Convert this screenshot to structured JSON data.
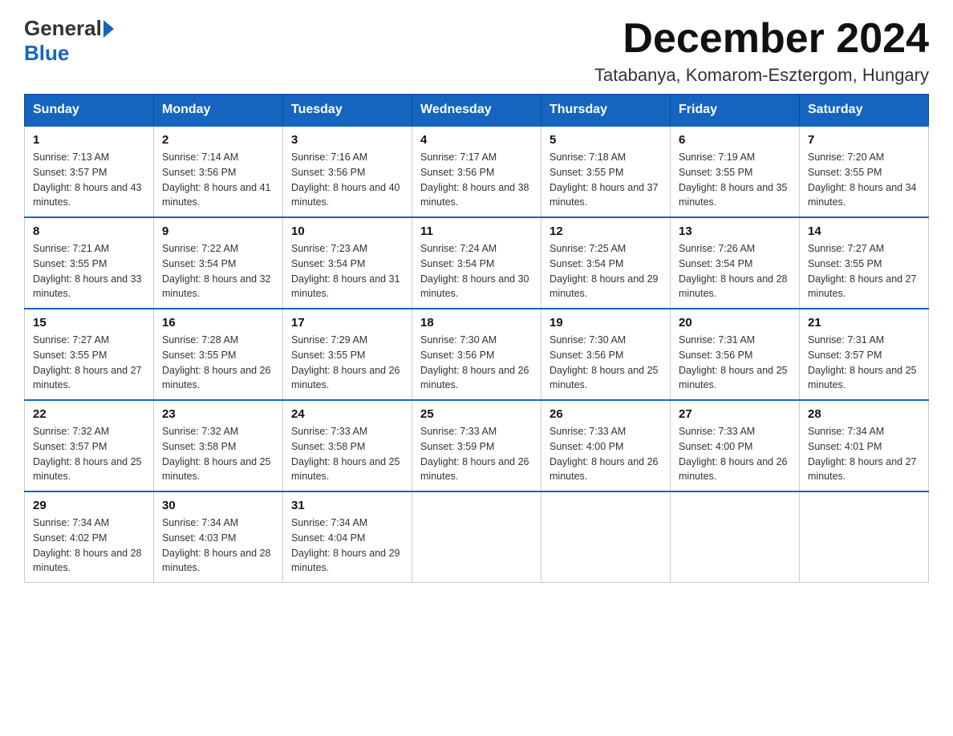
{
  "logo": {
    "general": "General",
    "blue": "Blue"
  },
  "title": "December 2024",
  "location": "Tatabanya, Komarom-Esztergom, Hungary",
  "weekdays": [
    "Sunday",
    "Monday",
    "Tuesday",
    "Wednesday",
    "Thursday",
    "Friday",
    "Saturday"
  ],
  "weeks": [
    [
      {
        "day": "1",
        "sunrise": "7:13 AM",
        "sunset": "3:57 PM",
        "daylight": "8 hours and 43 minutes."
      },
      {
        "day": "2",
        "sunrise": "7:14 AM",
        "sunset": "3:56 PM",
        "daylight": "8 hours and 41 minutes."
      },
      {
        "day": "3",
        "sunrise": "7:16 AM",
        "sunset": "3:56 PM",
        "daylight": "8 hours and 40 minutes."
      },
      {
        "day": "4",
        "sunrise": "7:17 AM",
        "sunset": "3:56 PM",
        "daylight": "8 hours and 38 minutes."
      },
      {
        "day": "5",
        "sunrise": "7:18 AM",
        "sunset": "3:55 PM",
        "daylight": "8 hours and 37 minutes."
      },
      {
        "day": "6",
        "sunrise": "7:19 AM",
        "sunset": "3:55 PM",
        "daylight": "8 hours and 35 minutes."
      },
      {
        "day": "7",
        "sunrise": "7:20 AM",
        "sunset": "3:55 PM",
        "daylight": "8 hours and 34 minutes."
      }
    ],
    [
      {
        "day": "8",
        "sunrise": "7:21 AM",
        "sunset": "3:55 PM",
        "daylight": "8 hours and 33 minutes."
      },
      {
        "day": "9",
        "sunrise": "7:22 AM",
        "sunset": "3:54 PM",
        "daylight": "8 hours and 32 minutes."
      },
      {
        "day": "10",
        "sunrise": "7:23 AM",
        "sunset": "3:54 PM",
        "daylight": "8 hours and 31 minutes."
      },
      {
        "day": "11",
        "sunrise": "7:24 AM",
        "sunset": "3:54 PM",
        "daylight": "8 hours and 30 minutes."
      },
      {
        "day": "12",
        "sunrise": "7:25 AM",
        "sunset": "3:54 PM",
        "daylight": "8 hours and 29 minutes."
      },
      {
        "day": "13",
        "sunrise": "7:26 AM",
        "sunset": "3:54 PM",
        "daylight": "8 hours and 28 minutes."
      },
      {
        "day": "14",
        "sunrise": "7:27 AM",
        "sunset": "3:55 PM",
        "daylight": "8 hours and 27 minutes."
      }
    ],
    [
      {
        "day": "15",
        "sunrise": "7:27 AM",
        "sunset": "3:55 PM",
        "daylight": "8 hours and 27 minutes."
      },
      {
        "day": "16",
        "sunrise": "7:28 AM",
        "sunset": "3:55 PM",
        "daylight": "8 hours and 26 minutes."
      },
      {
        "day": "17",
        "sunrise": "7:29 AM",
        "sunset": "3:55 PM",
        "daylight": "8 hours and 26 minutes."
      },
      {
        "day": "18",
        "sunrise": "7:30 AM",
        "sunset": "3:56 PM",
        "daylight": "8 hours and 26 minutes."
      },
      {
        "day": "19",
        "sunrise": "7:30 AM",
        "sunset": "3:56 PM",
        "daylight": "8 hours and 25 minutes."
      },
      {
        "day": "20",
        "sunrise": "7:31 AM",
        "sunset": "3:56 PM",
        "daylight": "8 hours and 25 minutes."
      },
      {
        "day": "21",
        "sunrise": "7:31 AM",
        "sunset": "3:57 PM",
        "daylight": "8 hours and 25 minutes."
      }
    ],
    [
      {
        "day": "22",
        "sunrise": "7:32 AM",
        "sunset": "3:57 PM",
        "daylight": "8 hours and 25 minutes."
      },
      {
        "day": "23",
        "sunrise": "7:32 AM",
        "sunset": "3:58 PM",
        "daylight": "8 hours and 25 minutes."
      },
      {
        "day": "24",
        "sunrise": "7:33 AM",
        "sunset": "3:58 PM",
        "daylight": "8 hours and 25 minutes."
      },
      {
        "day": "25",
        "sunrise": "7:33 AM",
        "sunset": "3:59 PM",
        "daylight": "8 hours and 26 minutes."
      },
      {
        "day": "26",
        "sunrise": "7:33 AM",
        "sunset": "4:00 PM",
        "daylight": "8 hours and 26 minutes."
      },
      {
        "day": "27",
        "sunrise": "7:33 AM",
        "sunset": "4:00 PM",
        "daylight": "8 hours and 26 minutes."
      },
      {
        "day": "28",
        "sunrise": "7:34 AM",
        "sunset": "4:01 PM",
        "daylight": "8 hours and 27 minutes."
      }
    ],
    [
      {
        "day": "29",
        "sunrise": "7:34 AM",
        "sunset": "4:02 PM",
        "daylight": "8 hours and 28 minutes."
      },
      {
        "day": "30",
        "sunrise": "7:34 AM",
        "sunset": "4:03 PM",
        "daylight": "8 hours and 28 minutes."
      },
      {
        "day": "31",
        "sunrise": "7:34 AM",
        "sunset": "4:04 PM",
        "daylight": "8 hours and 29 minutes."
      },
      null,
      null,
      null,
      null
    ]
  ]
}
